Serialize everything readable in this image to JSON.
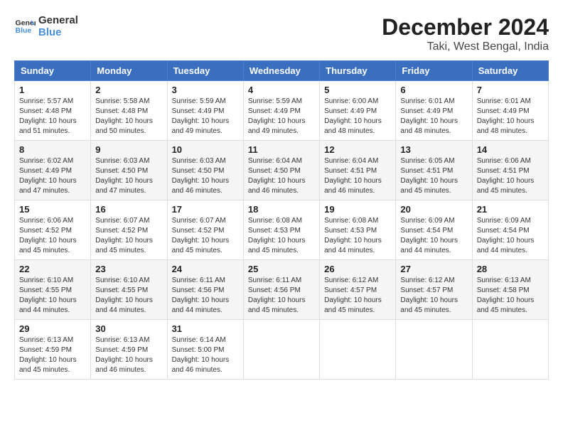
{
  "logo": {
    "line1": "General",
    "line2": "Blue"
  },
  "title": "December 2024",
  "subtitle": "Taki, West Bengal, India",
  "days_of_week": [
    "Sunday",
    "Monday",
    "Tuesday",
    "Wednesday",
    "Thursday",
    "Friday",
    "Saturday"
  ],
  "weeks": [
    [
      {
        "day": 1,
        "lines": [
          "Sunrise: 5:57 AM",
          "Sunset: 4:48 PM",
          "Daylight: 10 hours",
          "and 51 minutes."
        ]
      },
      {
        "day": 2,
        "lines": [
          "Sunrise: 5:58 AM",
          "Sunset: 4:48 PM",
          "Daylight: 10 hours",
          "and 50 minutes."
        ]
      },
      {
        "day": 3,
        "lines": [
          "Sunrise: 5:59 AM",
          "Sunset: 4:49 PM",
          "Daylight: 10 hours",
          "and 49 minutes."
        ]
      },
      {
        "day": 4,
        "lines": [
          "Sunrise: 5:59 AM",
          "Sunset: 4:49 PM",
          "Daylight: 10 hours",
          "and 49 minutes."
        ]
      },
      {
        "day": 5,
        "lines": [
          "Sunrise: 6:00 AM",
          "Sunset: 4:49 PM",
          "Daylight: 10 hours",
          "and 48 minutes."
        ]
      },
      {
        "day": 6,
        "lines": [
          "Sunrise: 6:01 AM",
          "Sunset: 4:49 PM",
          "Daylight: 10 hours",
          "and 48 minutes."
        ]
      },
      {
        "day": 7,
        "lines": [
          "Sunrise: 6:01 AM",
          "Sunset: 4:49 PM",
          "Daylight: 10 hours",
          "and 48 minutes."
        ]
      }
    ],
    [
      {
        "day": 8,
        "lines": [
          "Sunrise: 6:02 AM",
          "Sunset: 4:49 PM",
          "Daylight: 10 hours",
          "and 47 minutes."
        ]
      },
      {
        "day": 9,
        "lines": [
          "Sunrise: 6:03 AM",
          "Sunset: 4:50 PM",
          "Daylight: 10 hours",
          "and 47 minutes."
        ]
      },
      {
        "day": 10,
        "lines": [
          "Sunrise: 6:03 AM",
          "Sunset: 4:50 PM",
          "Daylight: 10 hours",
          "and 46 minutes."
        ]
      },
      {
        "day": 11,
        "lines": [
          "Sunrise: 6:04 AM",
          "Sunset: 4:50 PM",
          "Daylight: 10 hours",
          "and 46 minutes."
        ]
      },
      {
        "day": 12,
        "lines": [
          "Sunrise: 6:04 AM",
          "Sunset: 4:51 PM",
          "Daylight: 10 hours",
          "and 46 minutes."
        ]
      },
      {
        "day": 13,
        "lines": [
          "Sunrise: 6:05 AM",
          "Sunset: 4:51 PM",
          "Daylight: 10 hours",
          "and 45 minutes."
        ]
      },
      {
        "day": 14,
        "lines": [
          "Sunrise: 6:06 AM",
          "Sunset: 4:51 PM",
          "Daylight: 10 hours",
          "and 45 minutes."
        ]
      }
    ],
    [
      {
        "day": 15,
        "lines": [
          "Sunrise: 6:06 AM",
          "Sunset: 4:52 PM",
          "Daylight: 10 hours",
          "and 45 minutes."
        ]
      },
      {
        "day": 16,
        "lines": [
          "Sunrise: 6:07 AM",
          "Sunset: 4:52 PM",
          "Daylight: 10 hours",
          "and 45 minutes."
        ]
      },
      {
        "day": 17,
        "lines": [
          "Sunrise: 6:07 AM",
          "Sunset: 4:52 PM",
          "Daylight: 10 hours",
          "and 45 minutes."
        ]
      },
      {
        "day": 18,
        "lines": [
          "Sunrise: 6:08 AM",
          "Sunset: 4:53 PM",
          "Daylight: 10 hours",
          "and 45 minutes."
        ]
      },
      {
        "day": 19,
        "lines": [
          "Sunrise: 6:08 AM",
          "Sunset: 4:53 PM",
          "Daylight: 10 hours",
          "and 44 minutes."
        ]
      },
      {
        "day": 20,
        "lines": [
          "Sunrise: 6:09 AM",
          "Sunset: 4:54 PM",
          "Daylight: 10 hours",
          "and 44 minutes."
        ]
      },
      {
        "day": 21,
        "lines": [
          "Sunrise: 6:09 AM",
          "Sunset: 4:54 PM",
          "Daylight: 10 hours",
          "and 44 minutes."
        ]
      }
    ],
    [
      {
        "day": 22,
        "lines": [
          "Sunrise: 6:10 AM",
          "Sunset: 4:55 PM",
          "Daylight: 10 hours",
          "and 44 minutes."
        ]
      },
      {
        "day": 23,
        "lines": [
          "Sunrise: 6:10 AM",
          "Sunset: 4:55 PM",
          "Daylight: 10 hours",
          "and 44 minutes."
        ]
      },
      {
        "day": 24,
        "lines": [
          "Sunrise: 6:11 AM",
          "Sunset: 4:56 PM",
          "Daylight: 10 hours",
          "and 44 minutes."
        ]
      },
      {
        "day": 25,
        "lines": [
          "Sunrise: 6:11 AM",
          "Sunset: 4:56 PM",
          "Daylight: 10 hours",
          "and 45 minutes."
        ]
      },
      {
        "day": 26,
        "lines": [
          "Sunrise: 6:12 AM",
          "Sunset: 4:57 PM",
          "Daylight: 10 hours",
          "and 45 minutes."
        ]
      },
      {
        "day": 27,
        "lines": [
          "Sunrise: 6:12 AM",
          "Sunset: 4:57 PM",
          "Daylight: 10 hours",
          "and 45 minutes."
        ]
      },
      {
        "day": 28,
        "lines": [
          "Sunrise: 6:13 AM",
          "Sunset: 4:58 PM",
          "Daylight: 10 hours",
          "and 45 minutes."
        ]
      }
    ],
    [
      {
        "day": 29,
        "lines": [
          "Sunrise: 6:13 AM",
          "Sunset: 4:59 PM",
          "Daylight: 10 hours",
          "and 45 minutes."
        ]
      },
      {
        "day": 30,
        "lines": [
          "Sunrise: 6:13 AM",
          "Sunset: 4:59 PM",
          "Daylight: 10 hours",
          "and 46 minutes."
        ]
      },
      {
        "day": 31,
        "lines": [
          "Sunrise: 6:14 AM",
          "Sunset: 5:00 PM",
          "Daylight: 10 hours",
          "and 46 minutes."
        ]
      },
      null,
      null,
      null,
      null
    ]
  ]
}
